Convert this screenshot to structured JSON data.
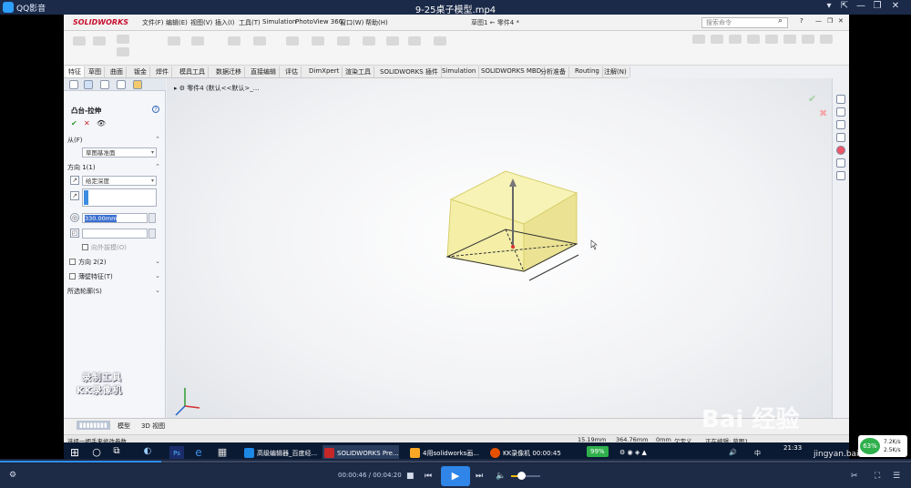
{
  "player": {
    "app_name": "QQ影音",
    "file_name": "9-25桌子模型.mp4",
    "controls": {
      "restore": "⇱",
      "menu": "▾",
      "minimize": "—",
      "maximize": "❐",
      "close": "✕"
    },
    "time_current": "00:00:46",
    "time_total": "00:04:20",
    "time_sep": " / ",
    "progress_fraction": 0.177,
    "volume_fraction": 0.35
  },
  "sw": {
    "logo": "SOLIDWORKS",
    "menus": [
      "文件(F)",
      "编辑(E)",
      "视图(V)",
      "插入(I)",
      "工具(T)",
      "Simulation",
      "PhotoView 360",
      "窗口(W)",
      "帮助(H)"
    ],
    "doc_title": "草图1 ← 零件4 *",
    "search_placeholder": "搜索命令",
    "tabs": [
      "特征",
      "草图",
      "曲面",
      "钣金",
      "焊件",
      "模具工具",
      "数据迁移",
      "直接编辑",
      "评估",
      "DimXpert",
      "渲染工具",
      "SOLIDWORKS 插件",
      "Simulation",
      "SOLIDWORKS MBD",
      "分析准备",
      "Routing",
      "注解(N)"
    ],
    "active_tab": 0,
    "tree_item": "零件4 (默认<<默认>_..."
  },
  "pm": {
    "title": "凸台-拉伸",
    "ok": "✔",
    "cancel": "✕",
    "preview": "👁",
    "help": "?",
    "from_label": "从(F)",
    "from_value": "草图基准面",
    "dir1_label": "方向 1(1)",
    "end_condition": "给定深度",
    "depth_value": "330.00mm",
    "outward_label": "向外拔模(O)",
    "dir2_label": "方向 2(2)",
    "thin_label": "薄壁特征(T)",
    "contours_label": "所选轮廓(S)"
  },
  "status": {
    "model_tab": "模型",
    "view3d_tab": "3D 视图",
    "hint": "选择一把手来修改参数",
    "coord1": "15.19mm",
    "coord2": "364.76mm",
    "coord3": "0mm",
    "state": "欠定义",
    "edit": "正在编辑: 草图1"
  },
  "watermark": {
    "line1": "录制工具",
    "line2": "KK录像机"
  },
  "taskbar": {
    "apps": [
      {
        "label": "高级编辑器_百度经...",
        "color": "#1e88e5"
      },
      {
        "label": "SOLIDWORKS Pre...",
        "color": "#c62828"
      },
      {
        "label": "4用solidworks画...",
        "color": "#f9a825"
      },
      {
        "label": "KK录像机 00:00:45",
        "color": "#e65100"
      }
    ],
    "battery": "99%",
    "ime": "中",
    "clock": "21:33"
  },
  "overlay": {
    "baidu": "Bai 经验",
    "url": "jingyan.baidu.com",
    "speed_pct": "63%",
    "speed_up": "7.2K/s",
    "speed_down": "2.5K/s"
  },
  "colors": {
    "accent": "#2f86e8",
    "solid_top": "#f6f2b0",
    "solid_side": "#ede79a"
  }
}
